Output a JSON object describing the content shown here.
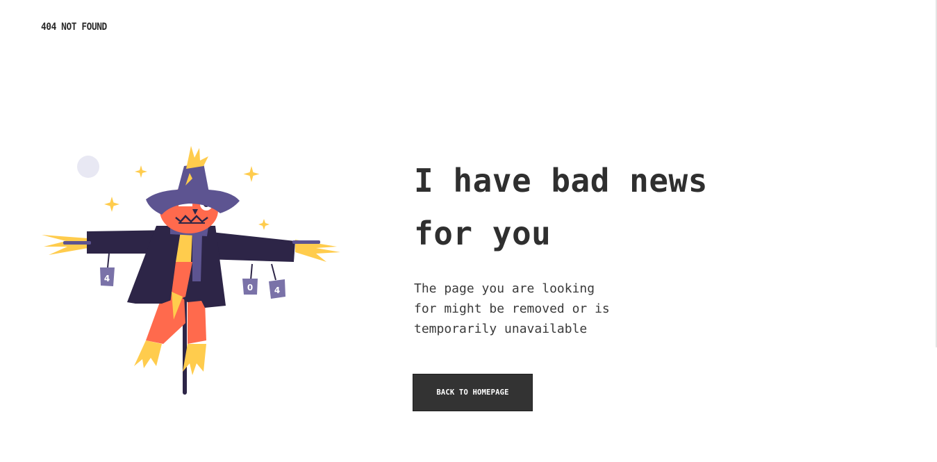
{
  "header": {
    "brand_text": "404 NOT FOUND"
  },
  "illustration": {
    "subject": "scarecrow",
    "can_labels": [
      "4",
      "0",
      "4"
    ],
    "colors": {
      "coat": "#2d2547",
      "hat": "#5d5491",
      "face": "#ff6a4d",
      "straw": "#ffcc4d",
      "scarf": "#5d5491",
      "cans": "#7a72a8",
      "moon": "#e8e8f3"
    }
  },
  "main": {
    "headline_line1": "I have bad news",
    "headline_line2": "for you",
    "description_line1": "The page you are looking",
    "description_line2": "for might be removed or is",
    "description_line3": "temporarily unavailable",
    "button_label": "BACK TO HOMEPAGE"
  },
  "colors": {
    "text": "#2f2f2f",
    "button_bg": "#333333",
    "button_text": "#ffffff",
    "background": "#ffffff"
  }
}
